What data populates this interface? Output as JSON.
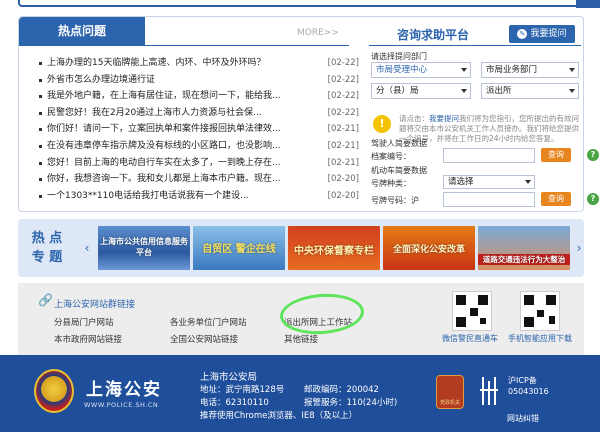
{
  "hot": {
    "title": "热点问题",
    "more": "MORE>>",
    "questions": [
      {
        "text": "上海办理的15天临牌能上高速、内环、中环及外环吗？",
        "date": "[02-22]"
      },
      {
        "text": "外省市怎么办理边境通行证",
        "date": "[02-22]"
      },
      {
        "text": "我是外地户籍，在上海有居住证，现在想问一下，能给我...",
        "date": "[02-22]"
      },
      {
        "text": "民警您好！我在2月20通过上海市人力资源与社会保...",
        "date": "[02-22]"
      },
      {
        "text": "你们好！请问一下，立案回执单和案件接报回执单法律效...",
        "date": "[02-21]"
      },
      {
        "text": "在没有违章停车指示牌及没有标线的小区路口，也没影响...",
        "date": "[02-21]"
      },
      {
        "text": "您好！目前上海的电动自行车实在太多了，一到晚上存在...",
        "date": "[02-21]"
      },
      {
        "text": "你好，我想咨询一下。我和女儿都是上海本市户籍。现在...",
        "date": "[02-20]"
      },
      {
        "text": "一个1303**110电话给我打电话说我有一个建设...",
        "date": "[02-20]"
      }
    ]
  },
  "consult": {
    "title": "咨询求助平台",
    "ask_button": "我要提问",
    "dept_label": "请选择提问部门",
    "dept_select_1": "市局受理中心",
    "dept_select_2": "市局业务部门",
    "dept_select_3": "分（县）局",
    "dept_select_4": "派出所",
    "tip_prefix": "请点击：",
    "tip_link": "我要提问",
    "tip_rest": "我们将为您指引，您所提出的有效问题将交由本市公安机关工作人员接办。我们将给您提供一个编号，并将在工作日的24小时内给您答复。",
    "driver_label": "驾驶人简要数据",
    "archive_label": "档案编号：",
    "query_label": "查询",
    "vehicle_label": "机动车简要数据",
    "plate_type_label": "号牌种类：",
    "plate_type_value": "请选择",
    "plate_no_label": "号牌号码：沪"
  },
  "topics": {
    "label_1": "热 点",
    "label_2": "专 题",
    "banners": [
      {
        "text": "上海市公共信用信息服务平台"
      },
      {
        "text": "自贸区 警企在线"
      },
      {
        "text": "中央环保督察专栏"
      },
      {
        "text": "全面深化公安改革"
      },
      {
        "text": "道路交通违法行为大整治"
      }
    ]
  },
  "links": {
    "title": "上海公安网站群链接",
    "items": [
      "分县局门户网站",
      "各业务单位门户网站",
      "派出所网上工作站",
      "本市政府网站链接",
      "全国公安网站链接",
      "其他链接"
    ],
    "qr_1": "微信警民直通车",
    "qr_2": "手机智能应用下载"
  },
  "footer": {
    "brand": "上海公安",
    "url": "WWW.POLICE.SH.CN",
    "org": "上海市公安局",
    "address": "地址：武宁南路128号",
    "zip": "邮政编码：200042",
    "tel": "电话：62310110",
    "hotline": "报警服务：110(24小时)",
    "browser": "推荐使用Chrome浏览器、IE8（及以上）",
    "icp_1": "沪ICP备",
    "icp_2": "05043016",
    "report": "网站纠错",
    "badge_text": "党政机关"
  },
  "colors": {
    "primary": "#2c64ad",
    "footer_bg": "#1f4e9b",
    "query_btn": "#e8851e",
    "annotation": "#5ee45a"
  }
}
